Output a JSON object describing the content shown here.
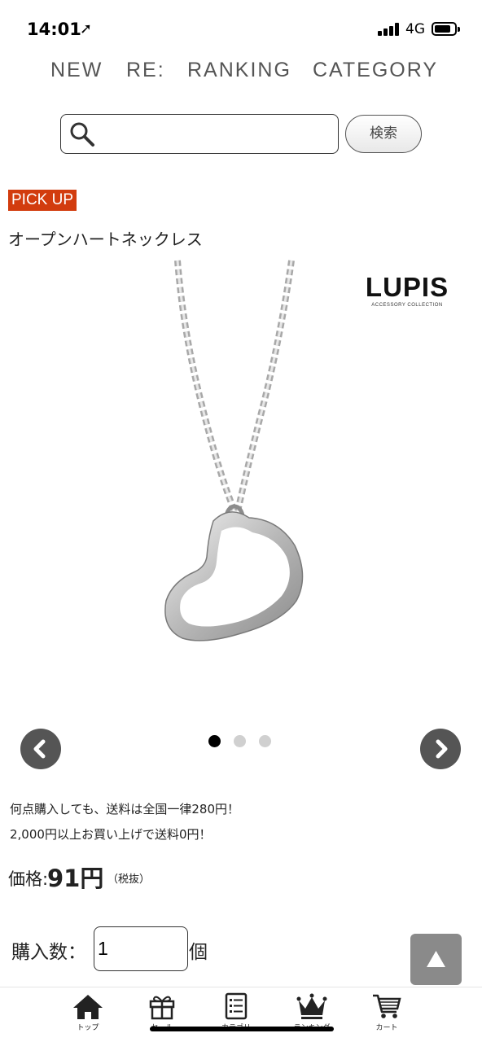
{
  "status_bar": {
    "time": "14:01",
    "network": "4G"
  },
  "top_nav": [
    "NEW",
    "RE:",
    "RANKING",
    "CATEGORY"
  ],
  "search": {
    "placeholder": "",
    "button_label": "検索"
  },
  "pickup_badge": "PICK UP",
  "product": {
    "title": "オープンハートネックレス",
    "brand_logo": "LUPIS",
    "brand_sub": "ACCESSORY COLLECTION",
    "carousel": {
      "total_slides": 3,
      "active_index": 0
    }
  },
  "shipping": {
    "line1": "何点購入しても、送料は全国一律280円！",
    "line2": "2,000円以上お買い上げで送料0円！"
  },
  "price": {
    "label": "価格:",
    "value": "91円",
    "tax_note": "（税抜）"
  },
  "quantity": {
    "label": "購入数：",
    "value": "1",
    "unit": "個"
  },
  "tabbar": [
    {
      "label": "トップ",
      "icon": "home-icon"
    },
    {
      "label": "セール",
      "icon": "gift-icon"
    },
    {
      "label": "カテゴリ",
      "icon": "list-icon"
    },
    {
      "label": "ランキング",
      "icon": "crown-icon"
    },
    {
      "label": "カート",
      "icon": "cart-icon"
    }
  ],
  "colors": {
    "pickup": "#d23c0e",
    "arrow": "#555555",
    "to_top": "#8a8a8a"
  }
}
